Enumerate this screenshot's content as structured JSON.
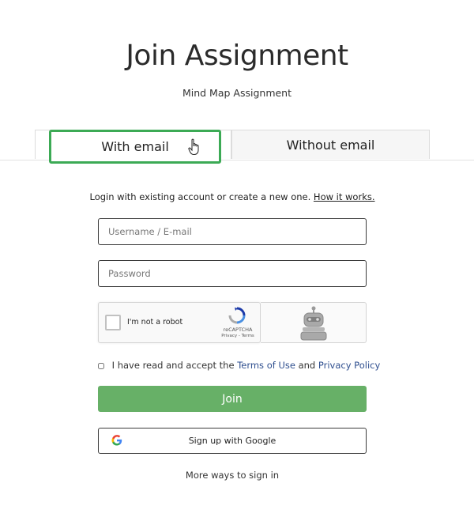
{
  "header": {
    "title": "Join Assignment",
    "subtitle": "Mind Map Assignment"
  },
  "tabs": [
    {
      "label": "With email",
      "active": true
    },
    {
      "label": "Without email",
      "active": false
    }
  ],
  "login": {
    "intro_text": "Login with existing account or create a new one.",
    "intro_link": "How it works.",
    "username_placeholder": "Username / E-mail",
    "password_placeholder": "Password"
  },
  "recaptcha": {
    "label": "I'm not a robot",
    "brand": "reCAPTCHA",
    "links": "Privacy - Terms"
  },
  "terms": {
    "prefix": "I have read and accept the",
    "terms_link": "Terms of Use",
    "and": "and",
    "privacy_link": "Privacy Policy"
  },
  "actions": {
    "join_label": "Join",
    "google_label": "Sign up with Google",
    "more_label": "More ways to sign in"
  },
  "colors": {
    "accent_green": "#67b067",
    "focus_green": "#3caa55",
    "link_blue": "#2f4f8f"
  }
}
